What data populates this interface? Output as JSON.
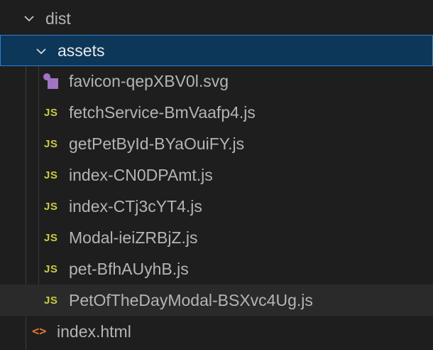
{
  "explorer": {
    "dist": {
      "label": "dist",
      "expanded": true
    },
    "assets": {
      "label": "assets",
      "expanded": true,
      "selected": true
    },
    "files": [
      {
        "label": "favicon-qepXBV0l.svg",
        "icon": "svg-icon"
      },
      {
        "label": "fetchService-BmVaafp4.js",
        "icon": "JS"
      },
      {
        "label": "getPetById-BYaOuiFY.js",
        "icon": "JS"
      },
      {
        "label": "index-CN0DPAmt.js",
        "icon": "JS"
      },
      {
        "label": "index-CTj3cYT4.js",
        "icon": "JS"
      },
      {
        "label": "Modal-ieiZRBjZ.js",
        "icon": "JS"
      },
      {
        "label": "pet-BfhAUyhB.js",
        "icon": "JS"
      },
      {
        "label": "PetOfTheDayModal-BSXvc4Ug.js",
        "icon": "JS"
      }
    ],
    "index_html": {
      "label": "index.html",
      "icon": "<>"
    }
  },
  "colors": {
    "background": "#1e1e1e",
    "selection": "#0c3758",
    "selection_border": "#2f7fd0",
    "js_icon": "#cbcb41",
    "svg_icon": "#a074c4",
    "html_icon": "#e37933"
  }
}
